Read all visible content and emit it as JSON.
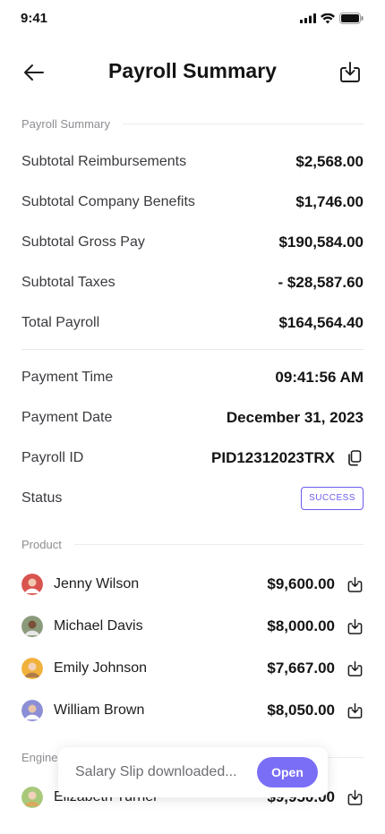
{
  "status_bar": {
    "time": "9:41"
  },
  "header": {
    "title": "Payroll Summary"
  },
  "summary": {
    "section_label": "Payroll Summary",
    "rows": [
      {
        "label": "Subtotal Reimbursements",
        "value": "$2,568.00"
      },
      {
        "label": "Subtotal Company Benefits",
        "value": "$1,746.00"
      },
      {
        "label": "Subtotal Gross Pay",
        "value": "$190,584.00"
      },
      {
        "label": "Subtotal Taxes",
        "value": "- $28,587.60"
      },
      {
        "label": "Total Payroll",
        "value": "$164,564.40"
      }
    ]
  },
  "payment": {
    "time_label": "Payment Time",
    "time_value": "09:41:56 AM",
    "date_label": "Payment Date",
    "date_value": "December 31, 2023",
    "id_label": "Payroll ID",
    "id_value": "PID12312023TRX",
    "status_label": "Status",
    "status_value": "SUCCESS"
  },
  "product": {
    "section_label": "Product",
    "people": [
      {
        "name": "Jenny Wilson",
        "amount": "$9,600.00",
        "avatar_color": "#d9534f"
      },
      {
        "name": "Michael Davis",
        "amount": "$8,000.00",
        "avatar_color": "#8a9a7b"
      },
      {
        "name": "Emily Johnson",
        "amount": "$7,667.00",
        "avatar_color": "#f0b23c"
      },
      {
        "name": "William Brown",
        "amount": "$8,050.00",
        "avatar_color": "#8c8fd6"
      }
    ]
  },
  "engineering": {
    "section_label": "Engine",
    "people": [
      {
        "name": "Elizabeth Turner",
        "amount": "$9,950.00",
        "avatar_color": "#a8c97a"
      }
    ]
  },
  "toast": {
    "message": "Salary Slip downloaded...",
    "action_label": "Open"
  },
  "colors": {
    "accent": "#7b6ef6",
    "badge": "#6b5cf0"
  }
}
